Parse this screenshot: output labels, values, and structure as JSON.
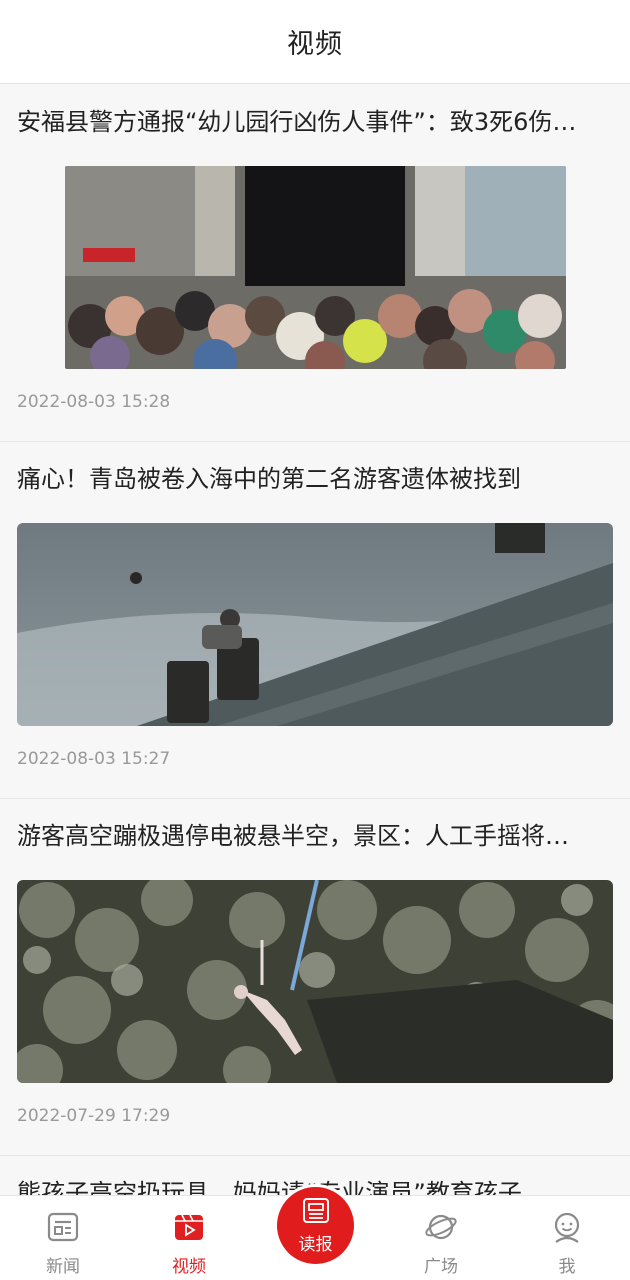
{
  "header": {
    "title": "视频"
  },
  "feed": [
    {
      "headline": "安福县警方通报“幼儿园行凶伤人事件”：致3死6伤…",
      "date": "2022-08-03 15:28"
    },
    {
      "headline": "痛心！青岛被卷入海中的第二名游客遗体被找到",
      "date": "2022-08-03 15:27"
    },
    {
      "headline": "游客高空蹦极遇停电被悬半空，景区：人工手摇将…",
      "date": "2022-07-29 17:29"
    },
    {
      "headline": "熊孩子高空扔玩具，妈妈请“专业演员”教育孩子",
      "date": ""
    }
  ],
  "tabbar": {
    "items": [
      {
        "label": "新闻",
        "icon": "news-icon"
      },
      {
        "label": "视频",
        "icon": "video-icon"
      },
      {
        "label": "读报",
        "icon": "newspaper-icon"
      },
      {
        "label": "广场",
        "icon": "planet-icon"
      },
      {
        "label": "我",
        "icon": "profile-icon"
      }
    ],
    "active": "视频",
    "active_color": "#e02020",
    "inactive_color": "#8a8a8a"
  }
}
